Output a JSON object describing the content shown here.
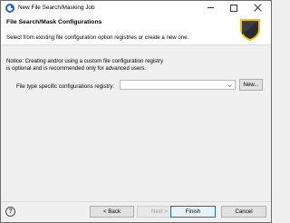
{
  "window": {
    "title": "New File Search/Masking Job",
    "controls": {
      "minimize": "minimize-icon",
      "maximize": "maximize-icon",
      "close": "close-icon"
    }
  },
  "banner": {
    "title": "File Search/Mask Configurations",
    "description": "Select from existing file configuration option registries or create a new one.",
    "image": "shield-icon"
  },
  "content": {
    "notice_line1": "Notice: Creating and/or using a custom file configuration registry",
    "notice_line2": "is optional and is recommended only for advanced users.",
    "registry_label": "File type specific configurations registry:",
    "registry_value": "",
    "new_button": "New..."
  },
  "footer": {
    "help_glyph": "?",
    "back": "< Back",
    "next": "Next >",
    "finish": "Finish",
    "cancel": "Cancel"
  },
  "colors": {
    "accent": "#0078d7",
    "app_icon": "#1b64c1",
    "shield": "#2b2b38",
    "shield_border": "#f2c200"
  }
}
